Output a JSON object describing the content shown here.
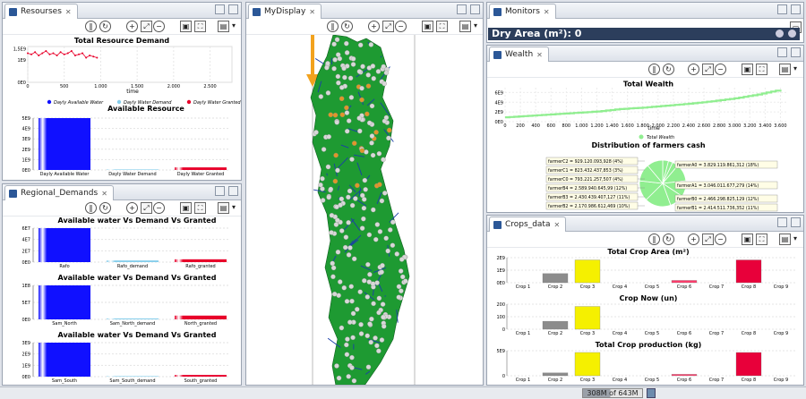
{
  "views": {
    "resources": "Resourses",
    "display": "MyDisplay",
    "monitors": "Monitors",
    "wealth": "Wealth",
    "regional": "Regional_Demands",
    "crops": "Crops_data"
  },
  "monitors": {
    "dry_area_label": "Dry Area (m²):  0"
  },
  "resources_chart": {
    "type": "line",
    "title": "Total Resource Demand",
    "xlabel": "time",
    "x_ticks": [
      "0",
      "500",
      "1.000",
      "1.500",
      "2.000",
      "2.500"
    ],
    "y_ticks": [
      "0E0",
      "1E9",
      "1,5E9"
    ],
    "legend": [
      "Dayly Available Water",
      "Dayly Water Demand",
      "Dayly Water Granted"
    ],
    "series": [
      {
        "name": "Dayly Water Granted",
        "x": [
          0,
          50,
          100,
          150,
          200,
          250,
          300,
          350,
          400,
          450,
          500,
          550,
          600,
          650,
          700,
          750,
          800,
          850,
          900,
          950
        ],
        "y": [
          1300000000.0,
          1250000000.0,
          1350000000.0,
          1200000000.0,
          1300000000.0,
          1400000000.0,
          1250000000.0,
          1300000000.0,
          1200000000.0,
          1350000000.0,
          1250000000.0,
          1300000000.0,
          1400000000.0,
          1200000000.0,
          1250000000.0,
          1300000000.0,
          1100000000.0,
          1200000000.0,
          1150000000.0,
          1100000000.0
        ]
      }
    ],
    "ylim": [
      0,
      1600000000.0
    ],
    "xlim": [
      0,
      2800
    ]
  },
  "available_resource": {
    "type": "bar",
    "title": "Available Resource",
    "categories": [
      "Dayly Available Water",
      "Dayly Water Demand",
      "Dayly Water Granted"
    ],
    "values": [
      5000000000.0,
      20000000.0,
      250000000.0
    ],
    "y_ticks": [
      "0E0",
      "1E9",
      "2E9",
      "3E9",
      "4E9",
      "5E9"
    ],
    "ylim": [
      0,
      5000000000.0
    ]
  },
  "regional": [
    {
      "title": "Available water Vs Demand Vs Granted",
      "categories": [
        "Rafo",
        "Rafo_demand",
        "Rafo_granted"
      ],
      "values": [
        60000000.0,
        3000000.0,
        5000000.0
      ],
      "y_ticks": [
        "0E0",
        "2E7",
        "4E7",
        "6E7"
      ],
      "ylim": [
        0,
        60000000.0
      ]
    },
    {
      "title": "Available water Vs Demand Vs Granted",
      "categories": [
        "Sam_North",
        "Sam_North_demand",
        "North_granted"
      ],
      "values": [
        180000000.0,
        5000000.0,
        20000000.0
      ],
      "y_ticks": [
        "0E0",
        "5E7",
        "1E8"
      ],
      "ylim": [
        0,
        180000000.0
      ]
    },
    {
      "title": "Available water Vs Demand Vs Granted",
      "categories": [
        "Sam_South",
        "Sam_South_demand",
        "South_granted"
      ],
      "values": [
        3000000000.0,
        30000000.0,
        150000000.0
      ],
      "y_ticks": [
        "0E0",
        "1E9",
        "2E9",
        "3E9"
      ],
      "ylim": [
        0,
        3000000000.0
      ]
    }
  ],
  "wealth_chart": {
    "type": "line",
    "title": "Total Wealth",
    "xlabel": "time",
    "legend": [
      "Total Wealth"
    ],
    "x_ticks": [
      "0",
      "200",
      "400",
      "600",
      "800",
      "1.000",
      "1.200",
      "1.400",
      "1.600",
      "1.800",
      "2.000",
      "2.200",
      "2.400",
      "2.600",
      "2.800",
      "3.000",
      "3.200",
      "3.400",
      "3.600"
    ],
    "y_ticks": [
      "0E0",
      "2E9",
      "4E9",
      "6E9"
    ],
    "x": [
      0,
      300,
      600,
      900,
      1200,
      1500,
      1800,
      2100,
      2400,
      2700,
      3000,
      3300,
      3600
    ],
    "y": [
      900000000.0,
      1200000000.0,
      1500000000.0,
      1800000000.0,
      2100000000.0,
      2600000000.0,
      2900000000.0,
      3300000000.0,
      3700000000.0,
      4200000000.0,
      4800000000.0,
      5600000000.0,
      6600000000.0
    ],
    "ylim": [
      0,
      7000000000.0
    ],
    "xlim": [
      0,
      3700
    ]
  },
  "farmers_pie": {
    "type": "pie",
    "title": "Distribution of farmers cash",
    "labels_left": [
      "farmerC2 = 929.120.093,928 (4%)",
      "farmerC1 = 823.432.437,853 (3%)",
      "farmerC0 = 793.221.257,507 (4%)",
      "farmerB4 = 2.589.940.645,99 (12%)",
      "farmerB3 = 2.430.439.407,127 (11%)",
      "farmerB2 = 2.170.986.612,469 (10%)"
    ],
    "labels_right": [
      "farmerA0 = 3.829.119.861,312 (18%)",
      "farmerA1 = 3.046.011.677,279 (14%)",
      "farmerB0 = 2.466.298.825,129 (12%)",
      "farmerB1 = 2.414.511.736,352 (11%)"
    ],
    "values": [
      4,
      3,
      4,
      12,
      11,
      10,
      18,
      14,
      12,
      11
    ]
  },
  "crops": [
    {
      "title": "Total Crop Area (m²)",
      "y_ticks": [
        "0E0",
        "1E9",
        "2E9"
      ],
      "ylim": [
        0,
        2200000000.0
      ],
      "values": [
        0,
        800000000.0,
        2000000000.0,
        0,
        0,
        200000000.0,
        0,
        2000000000.0,
        0
      ]
    },
    {
      "title": "Crop Now (un)",
      "y_ticks": [
        "0",
        "100",
        "200"
      ],
      "ylim": [
        0,
        220
      ],
      "values": [
        0,
        70,
        200,
        0,
        0,
        0,
        0,
        0,
        0
      ]
    },
    {
      "title": "Total Crop production (kg)",
      "y_ticks": [
        "0",
        "5E9"
      ],
      "ylim": [
        0,
        7000000000.0
      ],
      "values": [
        0,
        800000000.0,
        6500000000.0,
        0,
        0,
        400000000.0,
        0,
        6500000000.0,
        0
      ]
    }
  ],
  "crop_categories": [
    "Crop 1",
    "Crop 2",
    "Crop 3",
    "Crop 4",
    "Crop 5",
    "Crop 6",
    "Crop 7",
    "Crop 8",
    "Crop 9"
  ],
  "crop_colors": [
    "#8aa4c8",
    "#8c8c8c",
    "#f5f000",
    "#ff9f3f",
    "#8fd6ff",
    "#ff3b6b",
    "#9acd32",
    "#e8003a",
    "#66cccc"
  ],
  "colors": {
    "available": "#1010ff",
    "demand": "#87ceeb",
    "granted": "#e8002a",
    "wealth": "#90ee90",
    "map_land": "#1e9a32",
    "map_river": "#1a3ea8",
    "map_dot_light": "#d8d8d8",
    "map_dot_orange": "#e0962a"
  },
  "status": {
    "memory": "308M of 643M"
  }
}
